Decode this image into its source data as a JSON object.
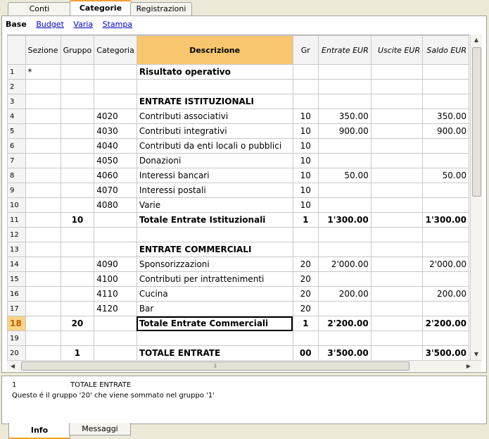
{
  "tabs": [
    "Conti",
    "Categorie",
    "Registrazioni"
  ],
  "views": {
    "current": "Base",
    "links": [
      "Budget",
      "Varia",
      "Stampa"
    ]
  },
  "columns": [
    "",
    "Sezione",
    "Gruppo",
    "Categoria",
    "Descrizione",
    "Gr",
    "Entrate EUR",
    "Uscite EUR",
    "Saldo EUR"
  ],
  "rows": [
    {
      "n": "1",
      "sez": "*",
      "grp": "",
      "cat": "",
      "desc": "Risultato operativo",
      "gr": "",
      "ent": "",
      "usc": "",
      "sal": "",
      "bold": true
    },
    {
      "n": "2",
      "sez": "",
      "grp": "",
      "cat": "",
      "desc": "",
      "gr": "",
      "ent": "",
      "usc": "",
      "sal": "",
      "bold": false
    },
    {
      "n": "3",
      "sez": "",
      "grp": "",
      "cat": "",
      "desc": "ENTRATE ISTITUZIONALI",
      "gr": "",
      "ent": "",
      "usc": "",
      "sal": "",
      "bold": true
    },
    {
      "n": "4",
      "sez": "",
      "grp": "",
      "cat": "4020",
      "desc": "Contributi associativi",
      "gr": "10",
      "ent": "350.00",
      "usc": "",
      "sal": "350.00",
      "bold": false
    },
    {
      "n": "5",
      "sez": "",
      "grp": "",
      "cat": "4030",
      "desc": "Contributi integrativi",
      "gr": "10",
      "ent": "900.00",
      "usc": "",
      "sal": "900.00",
      "bold": false
    },
    {
      "n": "6",
      "sez": "",
      "grp": "",
      "cat": "4040",
      "desc": "Contributi da enti locali o pubblici",
      "gr": "10",
      "ent": "",
      "usc": "",
      "sal": "",
      "bold": false
    },
    {
      "n": "7",
      "sez": "",
      "grp": "",
      "cat": "4050",
      "desc": "Donazioni",
      "gr": "10",
      "ent": "",
      "usc": "",
      "sal": "",
      "bold": false
    },
    {
      "n": "8",
      "sez": "",
      "grp": "",
      "cat": "4060",
      "desc": "Interessi bancari",
      "gr": "10",
      "ent": "50.00",
      "usc": "",
      "sal": "50.00",
      "bold": false
    },
    {
      "n": "9",
      "sez": "",
      "grp": "",
      "cat": "4070",
      "desc": "Interessi postali",
      "gr": "10",
      "ent": "",
      "usc": "",
      "sal": "",
      "bold": false
    },
    {
      "n": "10",
      "sez": "",
      "grp": "",
      "cat": "4080",
      "desc": "Varie",
      "gr": "10",
      "ent": "",
      "usc": "",
      "sal": "",
      "bold": false
    },
    {
      "n": "11",
      "sez": "",
      "grp": "10",
      "cat": "",
      "desc": "Totale Entrate Istituzionali",
      "gr": "1",
      "ent": "1'300.00",
      "usc": "",
      "sal": "1'300.00",
      "bold": true
    },
    {
      "n": "12",
      "sez": "",
      "grp": "",
      "cat": "",
      "desc": "",
      "gr": "",
      "ent": "",
      "usc": "",
      "sal": "",
      "bold": false
    },
    {
      "n": "13",
      "sez": "",
      "grp": "",
      "cat": "",
      "desc": "ENTRATE COMMERCIALI",
      "gr": "",
      "ent": "",
      "usc": "",
      "sal": "",
      "bold": true
    },
    {
      "n": "14",
      "sez": "",
      "grp": "",
      "cat": "4090",
      "desc": "Sponsorizzazioni",
      "gr": "20",
      "ent": "2'000.00",
      "usc": "",
      "sal": "2'000.00",
      "bold": false
    },
    {
      "n": "15",
      "sez": "",
      "grp": "",
      "cat": "4100",
      "desc": "Contributi per intrattenimenti",
      "gr": "20",
      "ent": "",
      "usc": "",
      "sal": "",
      "bold": false
    },
    {
      "n": "16",
      "sez": "",
      "grp": "",
      "cat": "4110",
      "desc": "Cucina",
      "gr": "20",
      "ent": "200.00",
      "usc": "",
      "sal": "200.00",
      "bold": false
    },
    {
      "n": "17",
      "sez": "",
      "grp": "",
      "cat": "4120",
      "desc": "Bar",
      "gr": "20",
      "ent": "",
      "usc": "",
      "sal": "",
      "bold": false
    },
    {
      "n": "18",
      "sez": "",
      "grp": "20",
      "cat": "",
      "desc": "Totale Entrate Commerciali",
      "gr": "1",
      "ent": "2'200.00",
      "usc": "",
      "sal": "2'200.00",
      "bold": true,
      "selected": true
    },
    {
      "n": "19",
      "sez": "",
      "grp": "",
      "cat": "",
      "desc": "",
      "gr": "",
      "ent": "",
      "usc": "",
      "sal": "",
      "bold": false
    },
    {
      "n": "20",
      "sez": "",
      "grp": "1",
      "cat": "",
      "desc": "TOTALE ENTRATE",
      "gr": "00",
      "ent": "3'500.00",
      "usc": "",
      "sal": "3'500.00",
      "bold": true
    }
  ],
  "info": {
    "row": "1",
    "title": "TOTALE ENTRATE",
    "message": "Questo é il gruppo '20' che viene sommato nel gruppo '1'"
  },
  "bottom_tabs": [
    "Info",
    "Messaggi"
  ]
}
